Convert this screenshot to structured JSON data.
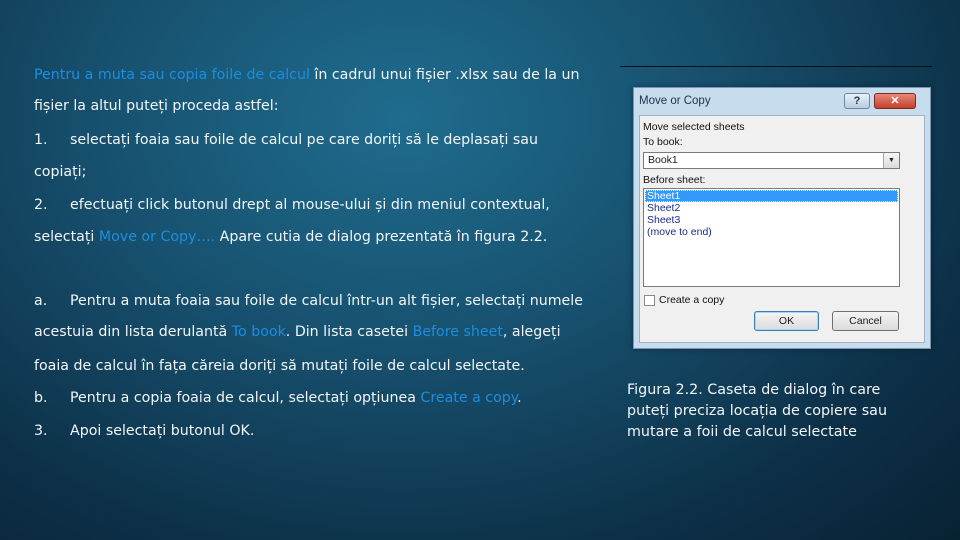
{
  "slide": {
    "intro": {
      "line1_hl": "Pentru a muta sau copia foile de calcul",
      "line1_rest": " în cadrul unui fișier .xlsx sau de la un",
      "line2": "fișier la altul puteți proceda astfel:"
    },
    "step1": {
      "num": "1.",
      "line1": "selectați foaia sau foile de calcul pe care doriți să le deplasați sau",
      "line2": "copiați;"
    },
    "step2": {
      "num": "2.",
      "line1": "efectuați click butonul drept al mouse-ului și din meniul contextual,",
      "line2_a": "selectați ",
      "line2_hl": "Move or Copy….",
      "line2_b": " Apare cutia de dialog prezentată în figura 2.2."
    },
    "step_a": {
      "num": "a.",
      "line1": "Pentru a muta foaia sau foile de calcul într-un alt fișier, selectați numele",
      "line2_a": "acestuia din lista derulantă ",
      "line2_hl1": "To book",
      "line2_b": ". Din lista casetei ",
      "line2_hl2": "Before sheet",
      "line2_c": ", alegeți",
      "line3": "foaia de calcul în fața căreia doriți să mutați foile de calcul selectate."
    },
    "step_b": {
      "num": "b.",
      "text_a": "Pentru a copia foaia de calcul, selectați opțiunea ",
      "text_hl": "Create a copy",
      "text_b": "."
    },
    "step_3": {
      "num": "3.",
      "text": "Apoi selectați butonul OK."
    }
  },
  "dialog": {
    "title": "Move or Copy",
    "help_label": "?",
    "close_label": "✕",
    "move_selected_label": "Move selected sheets",
    "to_book_label": "To book:",
    "to_book_value": "Book1",
    "before_sheet_label": "Before sheet:",
    "sheets": [
      "Sheet1",
      "Sheet2",
      "Sheet3",
      "(move to end)"
    ],
    "selected_index": 0,
    "create_copy_label": "Create a copy",
    "create_copy_checked": false,
    "ok_label": "OK",
    "cancel_label": "Cancel"
  },
  "caption": {
    "line1": "Figura 2.2. Caseta de dialog în care",
    "line2": "puteți preciza locația de copiere sau",
    "line3": "mutare a foii de calcul selectate"
  },
  "colors": {
    "highlight": "#1c8ee0",
    "background": "#17516f",
    "text": "#f2f6f8"
  }
}
